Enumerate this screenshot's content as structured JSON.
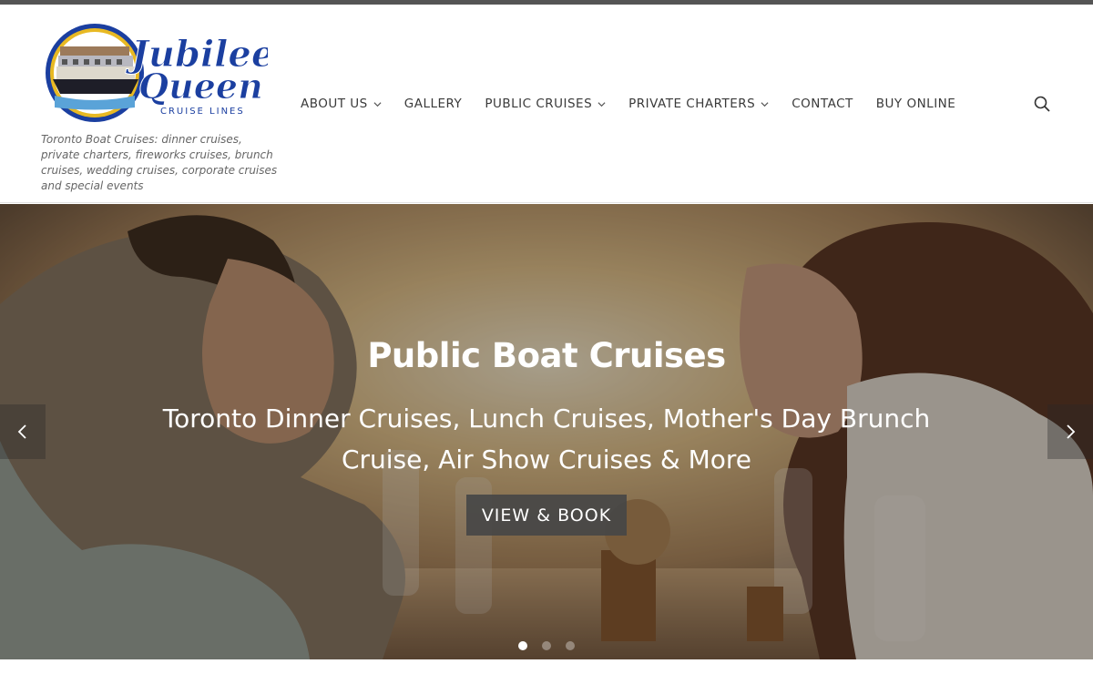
{
  "site": {
    "logo_alt": "Jubilee Queen Cruise Lines",
    "logo_line1": "Jubilee",
    "logo_line2": "Queen",
    "logo_line3": "CRUISE LINES",
    "tagline": "Toronto Boat Cruises: dinner cruises, private charters, fireworks cruises, brunch cruises, wedding cruises, corporate cruises and special events"
  },
  "nav": {
    "items": [
      {
        "label": "ABOUT US",
        "has_dropdown": true
      },
      {
        "label": "GALLERY",
        "has_dropdown": false
      },
      {
        "label": "PUBLIC CRUISES",
        "has_dropdown": true
      },
      {
        "label": "PRIVATE CHARTERS",
        "has_dropdown": true
      },
      {
        "label": "CONTACT",
        "has_dropdown": false
      },
      {
        "label": "BUY ONLINE",
        "has_dropdown": false
      }
    ],
    "search_icon": "search-icon"
  },
  "hero": {
    "title": "Public Boat Cruises",
    "subtitle": "Toronto Dinner Cruises, Lunch Cruises, Mother's Day Brunch Cruise, Air Show Cruises & More",
    "cta_label": "VIEW & BOOK",
    "prev_icon": "chevron-left-icon",
    "next_icon": "chevron-right-icon",
    "slide_count": 3,
    "active_slide": 1
  },
  "colors": {
    "top_strip": "#555555",
    "nav_text": "#3a3a3a",
    "logo_blue": "#1b3fa0",
    "logo_gold": "#e8b923",
    "cta_bg": "#464646"
  }
}
